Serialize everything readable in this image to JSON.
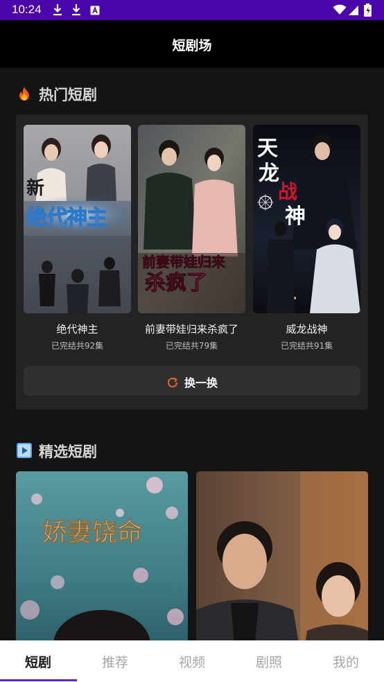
{
  "status_bar": {
    "time": "10:24",
    "bg_color": "#4a06a8",
    "left_icons": [
      "download-icon",
      "download-icon",
      "a-notification-icon"
    ],
    "right_icons": [
      "wifi-icon",
      "cellular-icon",
      "battery-icon"
    ]
  },
  "app_bar": {
    "title": "短剧场"
  },
  "hot_section": {
    "icon": "fire-icon",
    "title": "热门短剧",
    "dramas": [
      {
        "title": "绝代神主",
        "meta": "已完结共92集",
        "poster_text": "新\n绝代神主"
      },
      {
        "title": "前妻带娃归来杀疯了",
        "meta": "已完结共79集",
        "poster_text": "前妻带娃归来\n杀疯了"
      },
      {
        "title": "威龙战神",
        "meta": "已完结共91集",
        "poster_text": "天龙战神"
      }
    ],
    "refresh_label": "换一换",
    "refresh_icon": "refresh-icon",
    "accent_color": "#e8642e"
  },
  "featured_section": {
    "icon": "play-icon",
    "title": "精选短剧",
    "items": [
      {
        "poster_text": "娇妻饶命"
      },
      {
        "poster_text": ""
      }
    ]
  },
  "bottom_nav": {
    "items": [
      "短剧",
      "推荐",
      "视频",
      "剧照",
      "我的"
    ],
    "active_index": 0,
    "indicator_color": "#5b2bc4"
  }
}
